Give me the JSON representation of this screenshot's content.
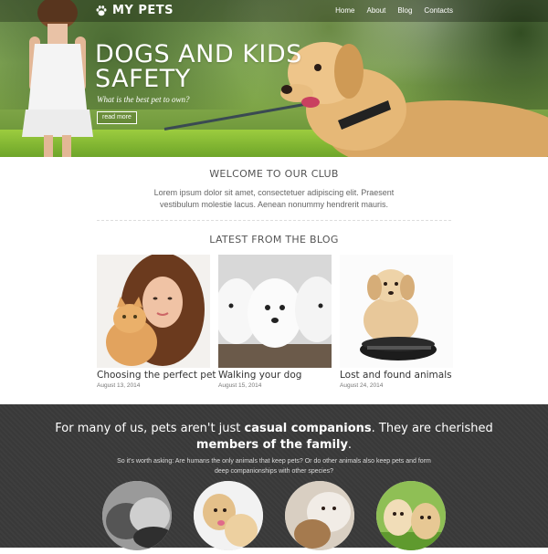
{
  "brand": {
    "name": "MY PETS",
    "logo_icon": "paw-icon"
  },
  "nav": {
    "items": [
      "Home",
      "About",
      "Blog",
      "Contacts"
    ]
  },
  "hero": {
    "title_line1": "DOGS AND KIDS",
    "title_line2": "SAFETY",
    "subtitle": "What is the best pet to own?",
    "button": "read more"
  },
  "welcome": {
    "heading": "WELCOME TO OUR CLUB",
    "text": "Lorem ipsum dolor sit amet, consectetuer adipiscing elit. Praesent vestibulum molestie lacus. Aenean nonummy hendrerit mauris."
  },
  "blog": {
    "heading": "LATEST FROM THE BLOG",
    "posts": [
      {
        "title": "Choosing the perfect pet",
        "date": "August 13, 2014"
      },
      {
        "title": "Walking your dog",
        "date": "August 15, 2014"
      },
      {
        "title": "Lost and found animals",
        "date": "August 24, 2014"
      }
    ]
  },
  "quote": {
    "part1": "For many of us, pets aren't just ",
    "bold1": "casual companions",
    "part2": ". They are cherished ",
    "bold2": "members of the family",
    "part3": ".",
    "sub": "So it's worth asking: Are humans the only animals that keep pets? Or do other animals also keep pets and form deep companionships with other species?"
  },
  "colors": {
    "dark_bg": "#3a3a3a",
    "accent_white": "#ffffff"
  }
}
